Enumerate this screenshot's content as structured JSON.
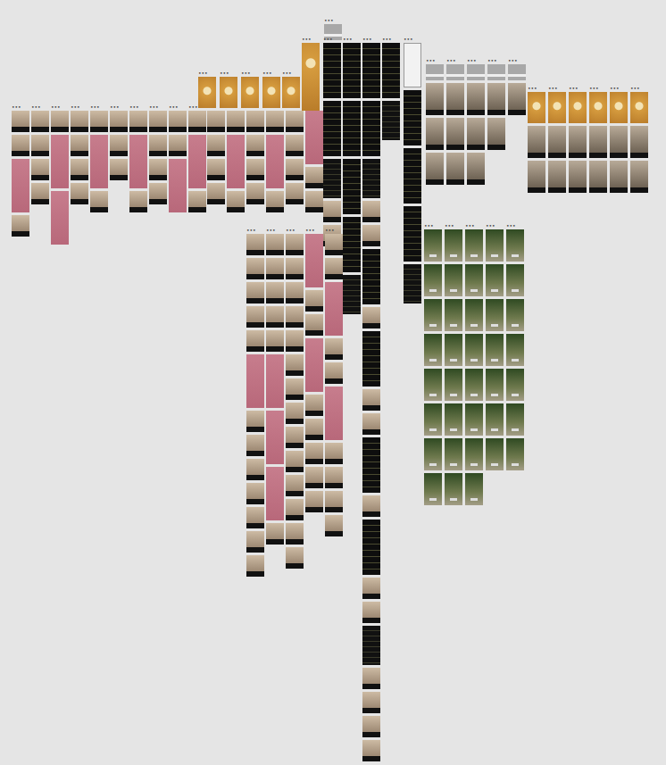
{
  "canvas": {
    "groups": [
      {
        "label": "•••",
        "frames": [
          {
            "kind": "photo"
          },
          {
            "kind": "photo"
          },
          {
            "kind": "pink"
          },
          {
            "kind": "photo"
          }
        ]
      },
      {
        "label": "•••",
        "frames": [
          {
            "kind": "photo"
          },
          {
            "kind": "photo"
          },
          {
            "kind": "photo"
          },
          {
            "kind": "photo"
          }
        ]
      },
      {
        "label": "•••",
        "frames": [
          {
            "kind": "photo"
          },
          {
            "kind": "pink"
          },
          {
            "kind": "pink"
          }
        ]
      },
      {
        "label": "•••",
        "frames": [
          {
            "kind": "photo"
          },
          {
            "kind": "photo"
          },
          {
            "kind": "photo"
          },
          {
            "kind": "photo"
          }
        ]
      },
      {
        "label": "•••",
        "frames": [
          {
            "kind": "photo"
          },
          {
            "kind": "pink"
          },
          {
            "kind": "photo"
          }
        ]
      },
      {
        "label": "•••",
        "frames": [
          {
            "kind": "photo"
          },
          {
            "kind": "photo"
          },
          {
            "kind": "photo"
          }
        ]
      },
      {
        "label": "•••",
        "frames": [
          {
            "kind": "photo"
          },
          {
            "kind": "pink"
          },
          {
            "kind": "photo"
          }
        ]
      },
      {
        "label": "•••",
        "frames": [
          {
            "kind": "photo"
          },
          {
            "kind": "photo"
          },
          {
            "kind": "photo"
          },
          {
            "kind": "photo"
          }
        ]
      },
      {
        "label": "•••",
        "frames": [
          {
            "kind": "photo"
          },
          {
            "kind": "photo"
          },
          {
            "kind": "pink"
          }
        ]
      },
      {
        "label": "•••",
        "frames": [
          {
            "kind": "photo"
          },
          {
            "kind": "pink"
          },
          {
            "kind": "photo"
          }
        ]
      },
      {
        "label": "•••",
        "frames": [
          {
            "kind": "photo"
          },
          {
            "kind": "photo"
          },
          {
            "kind": "photo"
          },
          {
            "kind": "photo"
          }
        ]
      },
      {
        "label": "•••",
        "frames": [
          {
            "kind": "photo"
          },
          {
            "kind": "pink"
          },
          {
            "kind": "photo"
          }
        ]
      },
      {
        "label": "•••",
        "frames": [
          {
            "kind": "photo"
          },
          {
            "kind": "photo"
          },
          {
            "kind": "photo"
          },
          {
            "kind": "photo"
          }
        ]
      },
      {
        "label": "•••",
        "frames": [
          {
            "kind": "photo"
          },
          {
            "kind": "pink"
          },
          {
            "kind": "photo"
          }
        ]
      },
      {
        "label": "•••",
        "frames": [
          {
            "kind": "photo"
          },
          {
            "kind": "photo"
          },
          {
            "kind": "photo"
          },
          {
            "kind": "photo"
          }
        ]
      },
      {
        "label": "•••",
        "frames": [
          {
            "kind": "pink"
          },
          {
            "kind": "photo"
          },
          {
            "kind": "photo"
          }
        ]
      },
      {
        "label": "•••",
        "frames": [
          {
            "kind": "gold"
          }
        ]
      },
      {
        "label": "•••",
        "frames": [
          {
            "kind": "gold"
          }
        ]
      },
      {
        "label": "•••",
        "frames": [
          {
            "kind": "gold"
          }
        ]
      },
      {
        "label": "•••",
        "frames": [
          {
            "kind": "gold"
          }
        ]
      },
      {
        "label": "•••",
        "frames": [
          {
            "kind": "gold"
          }
        ]
      },
      {
        "label": "•••",
        "frames": [
          {
            "kind": "gold-tall"
          }
        ]
      },
      {
        "label": "•••",
        "frames": [
          {
            "kind": "gray"
          }
        ]
      },
      {
        "label": "•••",
        "frames": [
          {
            "kind": "dark-xl"
          },
          {
            "kind": "dark-xl"
          },
          {
            "kind": "dark"
          },
          {
            "kind": "photo"
          },
          {
            "kind": "photo"
          }
        ]
      },
      {
        "label": "•••",
        "frames": [
          {
            "kind": "dark-xl"
          },
          {
            "kind": "dark-xl"
          },
          {
            "kind": "dark-xl"
          },
          {
            "kind": "dark-xl"
          },
          {
            "kind": "dark"
          }
        ]
      },
      {
        "label": "•••",
        "frames": [
          {
            "kind": "dark-xl"
          },
          {
            "kind": "dark-xl"
          },
          {
            "kind": "dark"
          },
          {
            "kind": "photo"
          },
          {
            "kind": "photo"
          },
          {
            "kind": "dark-xl"
          },
          {
            "kind": "photo"
          },
          {
            "kind": "dark-xl"
          },
          {
            "kind": "photo"
          },
          {
            "kind": "photo"
          },
          {
            "kind": "dark-xl"
          },
          {
            "kind": "photo"
          },
          {
            "kind": "dark-xl"
          },
          {
            "kind": "photo"
          },
          {
            "kind": "photo"
          },
          {
            "kind": "dark"
          },
          {
            "kind": "photo"
          },
          {
            "kind": "photo"
          },
          {
            "kind": "photo"
          },
          {
            "kind": "photo"
          }
        ]
      },
      {
        "label": "•••",
        "frames": [
          {
            "kind": "dark-xl"
          },
          {
            "kind": "dark"
          }
        ]
      },
      {
        "label": "•••",
        "frames": [
          {
            "kind": "white"
          },
          {
            "kind": "dark-xl"
          },
          {
            "kind": "dark-xl"
          },
          {
            "kind": "dark-xl"
          },
          {
            "kind": "dark"
          }
        ]
      },
      {
        "label": "•••",
        "frames": [
          {
            "kind": "photo"
          },
          {
            "kind": "photo"
          },
          {
            "kind": "photo"
          },
          {
            "kind": "photo"
          },
          {
            "kind": "photo"
          },
          {
            "kind": "pink"
          },
          {
            "kind": "photo"
          },
          {
            "kind": "photo"
          },
          {
            "kind": "photo"
          },
          {
            "kind": "photo"
          },
          {
            "kind": "photo"
          },
          {
            "kind": "photo"
          },
          {
            "kind": "photo"
          }
        ]
      },
      {
        "label": "•••",
        "frames": [
          {
            "kind": "photo"
          },
          {
            "kind": "photo"
          },
          {
            "kind": "photo"
          },
          {
            "kind": "photo"
          },
          {
            "kind": "photo"
          },
          {
            "kind": "pink"
          },
          {
            "kind": "pink"
          },
          {
            "kind": "pink"
          },
          {
            "kind": "photo"
          }
        ]
      },
      {
        "label": "•••",
        "frames": [
          {
            "kind": "photo"
          },
          {
            "kind": "photo"
          },
          {
            "kind": "photo"
          },
          {
            "kind": "photo"
          },
          {
            "kind": "photo"
          },
          {
            "kind": "photo"
          },
          {
            "kind": "photo"
          },
          {
            "kind": "photo"
          },
          {
            "kind": "photo"
          },
          {
            "kind": "photo"
          },
          {
            "kind": "photo"
          },
          {
            "kind": "photo"
          },
          {
            "kind": "photo"
          },
          {
            "kind": "photo"
          }
        ]
      },
      {
        "label": "•••",
        "frames": [
          {
            "kind": "pink"
          },
          {
            "kind": "photo"
          },
          {
            "kind": "photo"
          },
          {
            "kind": "pink"
          },
          {
            "kind": "photo"
          },
          {
            "kind": "photo"
          },
          {
            "kind": "photo"
          },
          {
            "kind": "photo"
          },
          {
            "kind": "photo"
          }
        ]
      },
      {
        "label": "•••",
        "frames": [
          {
            "kind": "photo"
          },
          {
            "kind": "photo"
          },
          {
            "kind": "pink"
          },
          {
            "kind": "photo"
          },
          {
            "kind": "photo"
          },
          {
            "kind": "pink"
          },
          {
            "kind": "photo"
          },
          {
            "kind": "photo"
          },
          {
            "kind": "photo"
          },
          {
            "kind": "photo"
          }
        ]
      },
      {
        "label": "•••",
        "frames": [
          {
            "kind": "gray"
          },
          {
            "kind": "photo-lg"
          },
          {
            "kind": "photo-lg"
          },
          {
            "kind": "photo-lg"
          }
        ]
      },
      {
        "label": "•••",
        "frames": [
          {
            "kind": "gray"
          },
          {
            "kind": "photo-lg"
          },
          {
            "kind": "photo-lg"
          },
          {
            "kind": "photo-lg"
          }
        ]
      },
      {
        "label": "•••",
        "frames": [
          {
            "kind": "gray"
          },
          {
            "kind": "photo-lg"
          },
          {
            "kind": "photo-lg"
          },
          {
            "kind": "photo-lg"
          }
        ]
      },
      {
        "label": "•••",
        "frames": [
          {
            "kind": "gray"
          },
          {
            "kind": "photo-lg"
          },
          {
            "kind": "photo-lg"
          }
        ]
      },
      {
        "label": "•••",
        "frames": [
          {
            "kind": "gray"
          },
          {
            "kind": "photo-lg"
          }
        ]
      },
      {
        "label": "•••",
        "frames": [
          {
            "kind": "gold"
          },
          {
            "kind": "photo-lg"
          },
          {
            "kind": "photo-lg"
          }
        ]
      },
      {
        "label": "•••",
        "frames": [
          {
            "kind": "gold"
          },
          {
            "kind": "photo-lg"
          },
          {
            "kind": "photo-lg"
          }
        ]
      },
      {
        "label": "•••",
        "frames": [
          {
            "kind": "gold"
          },
          {
            "kind": "photo-lg"
          },
          {
            "kind": "photo-lg"
          }
        ]
      },
      {
        "label": "•••",
        "frames": [
          {
            "kind": "gold"
          },
          {
            "kind": "photo-lg"
          },
          {
            "kind": "photo-lg"
          }
        ]
      },
      {
        "label": "•••",
        "frames": [
          {
            "kind": "gold"
          },
          {
            "kind": "photo-lg"
          },
          {
            "kind": "photo-lg"
          }
        ]
      },
      {
        "label": "•••",
        "frames": [
          {
            "kind": "gold"
          },
          {
            "kind": "photo-lg"
          },
          {
            "kind": "photo-lg"
          }
        ]
      },
      {
        "label": "•••",
        "frames": [
          {
            "kind": "nature"
          },
          {
            "kind": "nature"
          },
          {
            "kind": "nature"
          },
          {
            "kind": "nature"
          },
          {
            "kind": "nature"
          },
          {
            "kind": "nature"
          },
          {
            "kind": "nature"
          },
          {
            "kind": "nature"
          }
        ]
      },
      {
        "label": "•••",
        "frames": [
          {
            "kind": "nature"
          },
          {
            "kind": "nature"
          },
          {
            "kind": "nature"
          },
          {
            "kind": "nature"
          },
          {
            "kind": "nature"
          },
          {
            "kind": "nature"
          },
          {
            "kind": "nature"
          },
          {
            "kind": "nature"
          }
        ]
      },
      {
        "label": "•••",
        "frames": [
          {
            "kind": "nature"
          },
          {
            "kind": "nature"
          },
          {
            "kind": "nature"
          },
          {
            "kind": "nature"
          },
          {
            "kind": "nature"
          },
          {
            "kind": "nature"
          },
          {
            "kind": "nature"
          },
          {
            "kind": "nature"
          }
        ]
      },
      {
        "label": "•••",
        "frames": [
          {
            "kind": "nature"
          },
          {
            "kind": "nature"
          },
          {
            "kind": "nature"
          },
          {
            "kind": "nature"
          },
          {
            "kind": "nature"
          },
          {
            "kind": "nature"
          },
          {
            "kind": "nature"
          }
        ]
      },
      {
        "label": "•••",
        "frames": [
          {
            "kind": "nature"
          },
          {
            "kind": "nature"
          },
          {
            "kind": "nature"
          },
          {
            "kind": "nature"
          },
          {
            "kind": "nature"
          },
          {
            "kind": "nature"
          },
          {
            "kind": "nature"
          }
        ]
      }
    ]
  }
}
